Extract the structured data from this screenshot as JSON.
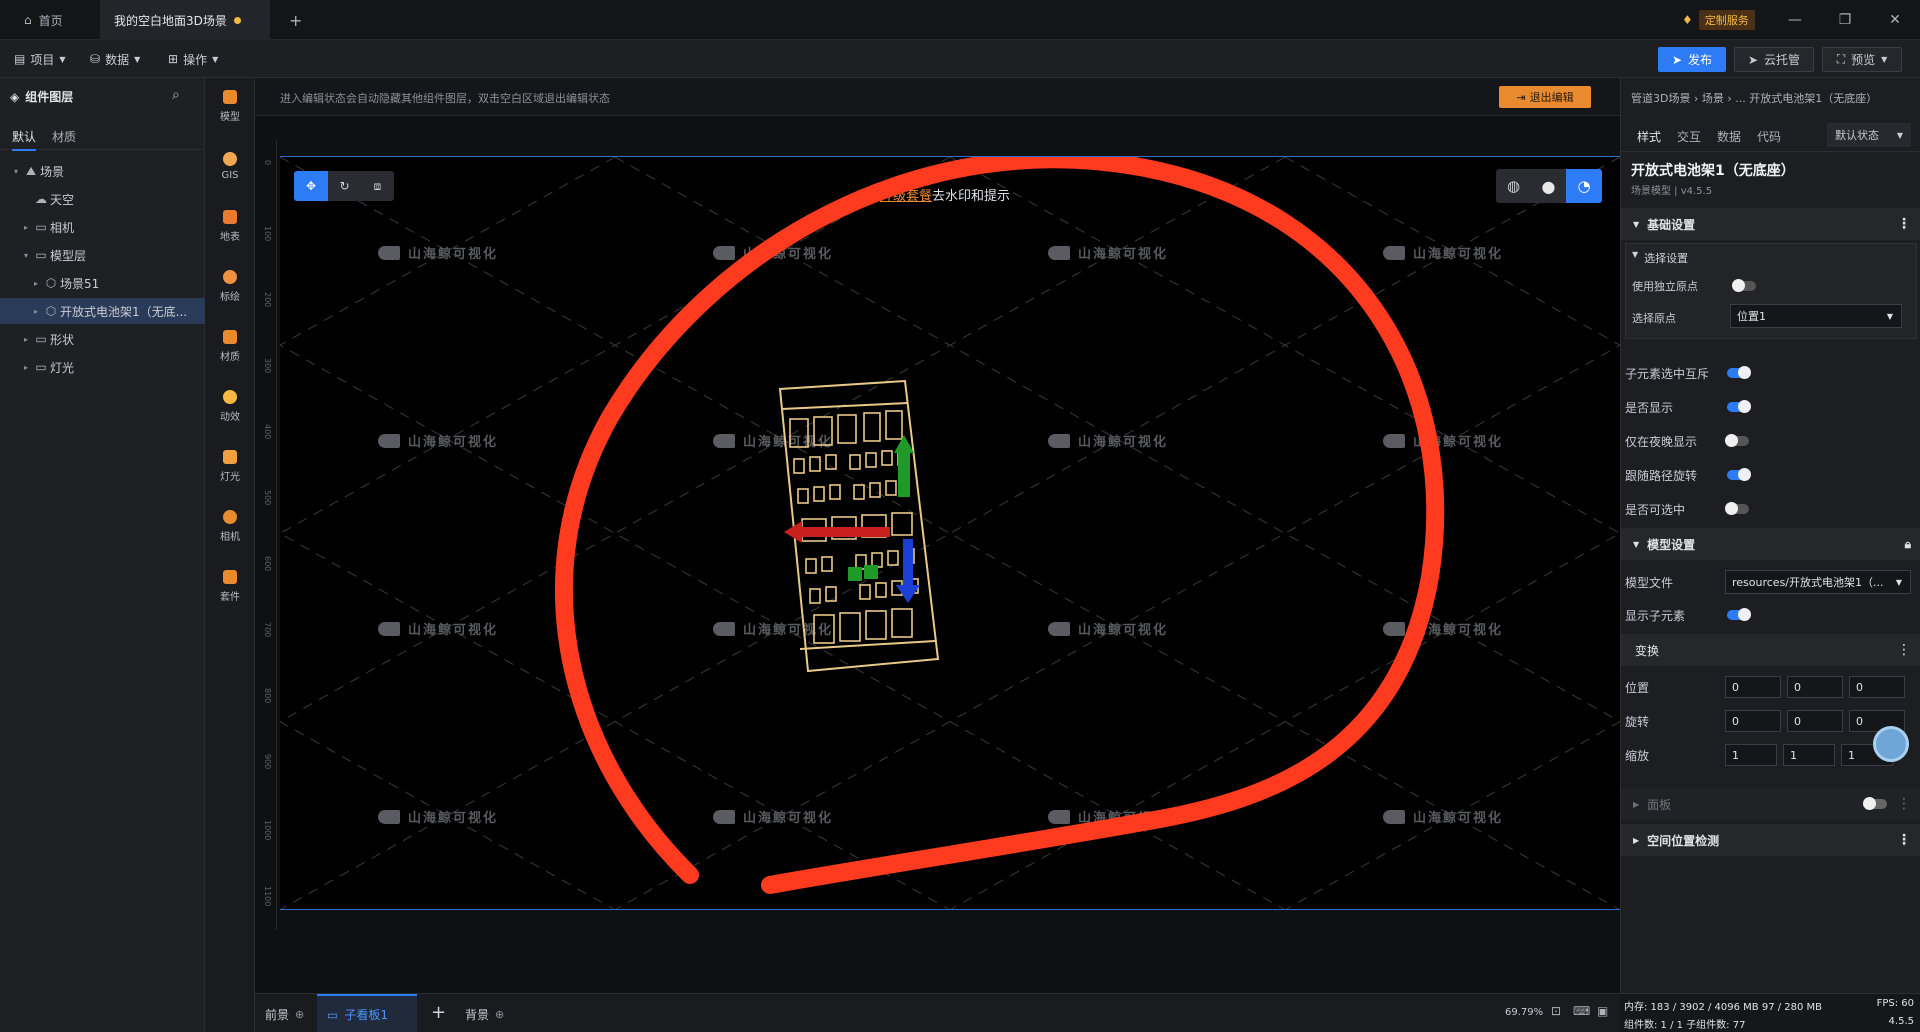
{
  "titlebar": {
    "home_tab": "首页",
    "doc_tab": "我的空白地面3D场景",
    "custom_service": "定制服务"
  },
  "menubar": {
    "project": "项目",
    "data": "数据",
    "operate": "操作",
    "publish": "发布",
    "cloud": "云托管",
    "preview": "预览"
  },
  "left_panel": {
    "title": "组件图层",
    "tabs": [
      "默认",
      "材质"
    ],
    "tree": [
      {
        "label": "场景",
        "level": 0,
        "caret": "▾",
        "icon": "scene"
      },
      {
        "label": "天空",
        "level": 1,
        "caret": "",
        "icon": "sky"
      },
      {
        "label": "相机",
        "level": 1,
        "caret": "▸",
        "icon": "folder"
      },
      {
        "label": "模型层",
        "level": 1,
        "caret": "▾",
        "icon": "folder"
      },
      {
        "label": "场景51",
        "level": 2,
        "caret": "▸",
        "icon": "cube"
      },
      {
        "label": "开放式电池架1（无底...",
        "level": 2,
        "caret": "▸",
        "icon": "cube",
        "selected": true
      },
      {
        "label": "形状",
        "level": 1,
        "caret": "▸",
        "icon": "folder"
      },
      {
        "label": "灯光",
        "level": 1,
        "caret": "▸",
        "icon": "folder"
      }
    ]
  },
  "icon_strip": [
    {
      "label": "模型",
      "icon": "model-icon"
    },
    {
      "label": "GIS",
      "icon": "gis-icon"
    },
    {
      "label": "地表",
      "icon": "terrain-icon"
    },
    {
      "label": "标绘",
      "icon": "marker-icon"
    },
    {
      "label": "材质",
      "icon": "material-icon"
    },
    {
      "label": "动效",
      "icon": "effect-icon"
    },
    {
      "label": "灯光",
      "icon": "light-icon"
    },
    {
      "label": "相机",
      "icon": "camera-icon"
    },
    {
      "label": "套件",
      "icon": "kit-icon"
    }
  ],
  "canvas": {
    "hint": "进入编辑状态会自动隐藏其他组件图层，双击空白区域退出编辑状态",
    "exit_edit": "退出编辑",
    "upgrade_link": "升级套餐",
    "upgrade_text": "去水印和提示",
    "watermark": "山海鲸可视化",
    "ruler_labels": [
      "0",
      "100",
      "200",
      "300",
      "400",
      "500",
      "600",
      "700",
      "800",
      "900",
      "1000",
      "1100"
    ]
  },
  "right_panel": {
    "breadcrumb": "管道3D场景 › 场景 › ...  开放式电池架1（无底座）",
    "tabs": [
      "样式",
      "交互",
      "数据",
      "代码"
    ],
    "state_select": "默认状态",
    "comp_title": "开放式电池架1（无底座）",
    "comp_sub": "场景模型 | v4.5.5",
    "basic_settings": "基础设置",
    "select_settings": "选择设置",
    "use_own_origin": "使用独立原点",
    "select_origin": "选择原点",
    "origin_value": "位置1",
    "child_exclusive": "子元素选中互斥",
    "visible": "是否显示",
    "night_only": "仅在夜晚显示",
    "follow_path": "跟随路径旋转",
    "selectable": "是否可选中",
    "model_settings": "模型设置",
    "model_file": "模型文件",
    "model_file_value": "resources/开放式电池架1（...",
    "show_children": "显示子元素",
    "transform": "变换",
    "position": "位置",
    "rotation": "旋转",
    "scale": "缩放",
    "pos_values": [
      "0",
      "0",
      "0"
    ],
    "rot_values": [
      "0",
      "0",
      "0"
    ],
    "scale_values": [
      "1",
      "1",
      "1"
    ],
    "panel": "面板",
    "space_detect": "空间位置检测"
  },
  "bottom": {
    "front": "前景",
    "child": "子看板1",
    "back": "背景",
    "zoom": "69.79%"
  },
  "status": {
    "memory": "内存: 183 / 3902 / 4096 MB  97 / 280 MB",
    "fps": "FPS: 60",
    "comp_count": "组件数: 1 / 1  子组件数: 77",
    "version": "4.5.5"
  },
  "colors": {
    "accent": "#2d7cf6",
    "orange": "#e98a2f",
    "annotation": "#ff3b1f",
    "model": "#e8c98a"
  }
}
